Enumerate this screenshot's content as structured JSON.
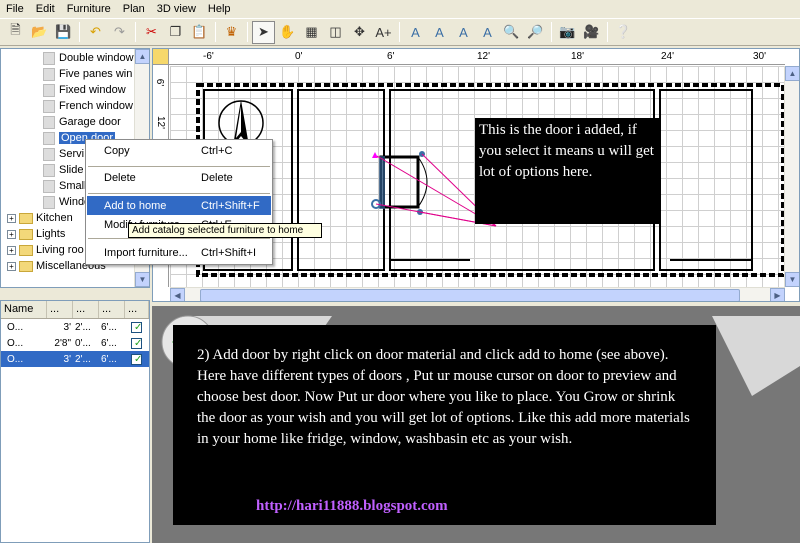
{
  "menu": {
    "items": [
      "File",
      "Edit",
      "Furniture",
      "Plan",
      "3D view",
      "Help"
    ]
  },
  "catalog": {
    "items": [
      {
        "label": "Double window"
      },
      {
        "label": "Five panes win"
      },
      {
        "label": "Fixed window"
      },
      {
        "label": "French window"
      },
      {
        "label": "Garage door"
      },
      {
        "label": "Open door"
      },
      {
        "label": "Servi"
      },
      {
        "label": "Slide"
      },
      {
        "label": "Small"
      },
      {
        "label": "Windo"
      }
    ],
    "categories": [
      {
        "label": "Kitchen"
      },
      {
        "label": "Lights"
      },
      {
        "label": "Living roo"
      },
      {
        "label": "Miscellaneous"
      }
    ]
  },
  "context_menu": {
    "items": [
      {
        "label": "Copy",
        "shortcut": "Ctrl+C"
      },
      {
        "label": "Delete",
        "shortcut": "Delete"
      },
      {
        "label": "Add to home",
        "shortcut": "Ctrl+Shift+F"
      },
      {
        "label": "Modify furniture...",
        "shortcut": "Ctrl+E"
      },
      {
        "label": "Import furniture...",
        "shortcut": "Ctrl+Shift+I"
      }
    ],
    "tooltip": "Add catalog selected furniture to home"
  },
  "furniture_list": {
    "headers": [
      "Name",
      "...",
      "...",
      "...",
      "..."
    ],
    "rows": [
      {
        "name": "O...",
        "w": "3'",
        "d": "2'...",
        "h": "6'...",
        "visible": true
      },
      {
        "name": "O...",
        "w": "2'8\"",
        "d": "0'...",
        "h": "6'...",
        "visible": true
      },
      {
        "name": "O...",
        "w": "3'",
        "d": "2'...",
        "h": "6'...",
        "visible": true
      }
    ]
  },
  "plan": {
    "ruler_top": [
      "-6'",
      "0'",
      "6'",
      "12'",
      "18'",
      "24'",
      "30'"
    ],
    "ruler_left": [
      "6'",
      "12'"
    ]
  },
  "annotations": {
    "note1": "This is the door i added, if you select it means u will get lot of options here.",
    "note2": "2) Add door by right click on door material and click add to home (see above). Here have different types of doors , Put ur mouse cursor on door to preview and choose best door. Now Put  ur door where you like to place. You Grow or shrink the door as your wish and you will get lot of options. Like this add more materials in your home like fridge, window, washbasin etc as your wish.",
    "blog": "http://hari11888.blogspot.com"
  },
  "colors": {
    "selection": "#316ac5",
    "window_bg": "#ece9d8",
    "annotation_bg": "#000000",
    "blog_link": "#c060ff"
  }
}
